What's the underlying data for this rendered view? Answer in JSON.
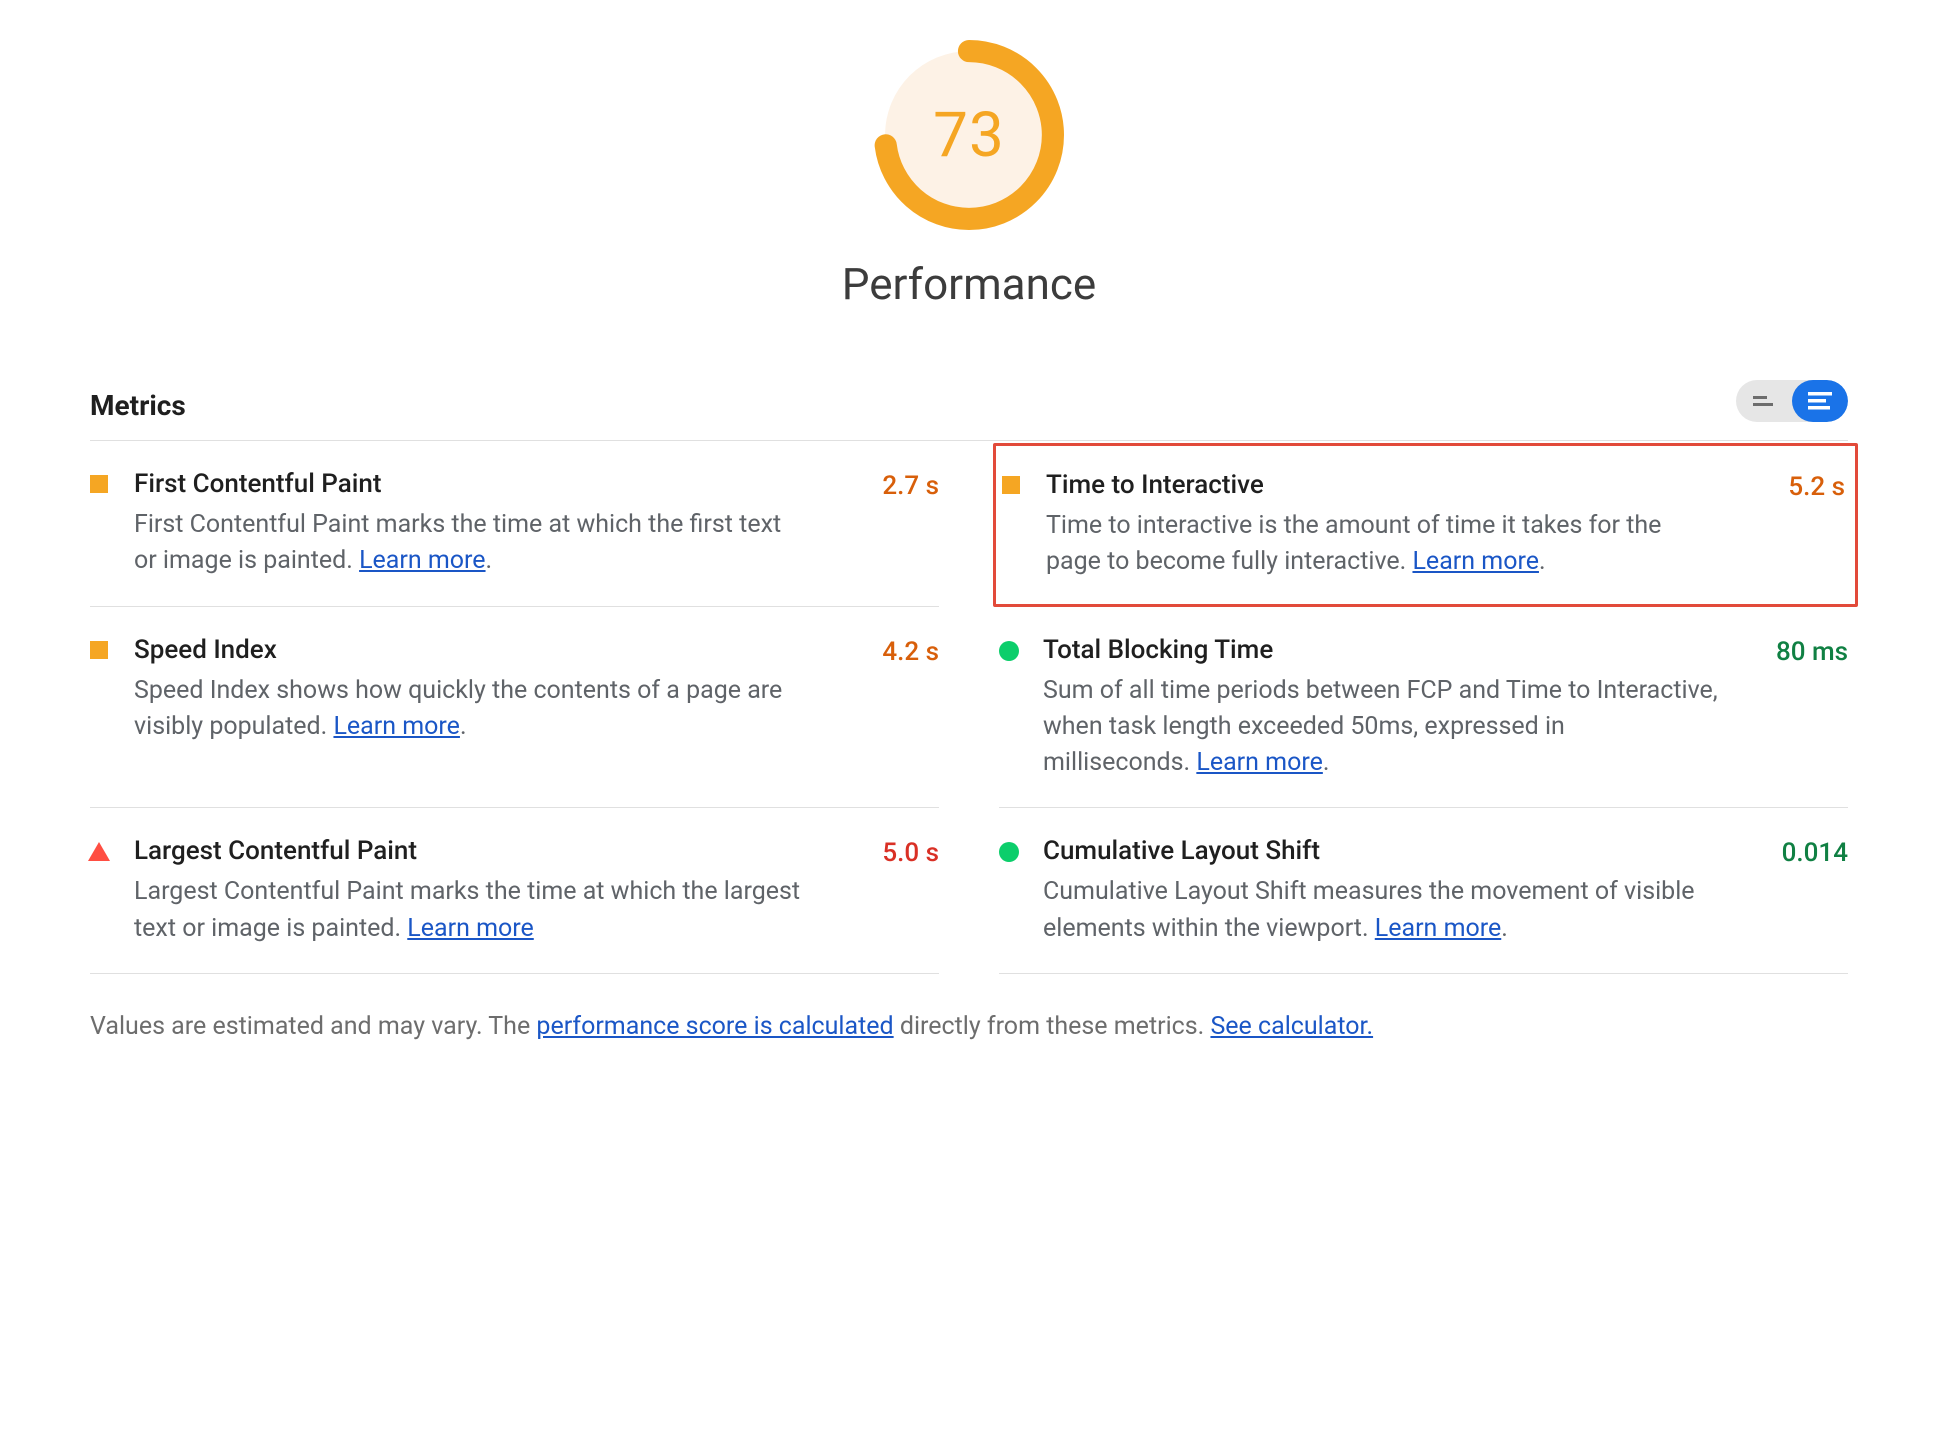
{
  "score": 73,
  "score_pct": 0.73,
  "title": "Performance",
  "section_heading": "Metrics",
  "metrics": [
    {
      "id": "fcp",
      "title": "First Contentful Paint",
      "desc_pre": "First Contentful Paint marks the time at which the first text or image is painted. ",
      "link": "Learn more",
      "desc_post": ".",
      "value": "2.7 s",
      "status": "avg",
      "icon": "square"
    },
    {
      "id": "tti",
      "title": "Time to Interactive",
      "desc_pre": "Time to interactive is the amount of time it takes for the page to become fully interactive. ",
      "link": "Learn more",
      "desc_post": ".",
      "value": "5.2 s",
      "status": "avg",
      "icon": "square",
      "highlight": true
    },
    {
      "id": "si",
      "title": "Speed Index",
      "desc_pre": "Speed Index shows how quickly the contents of a page are visibly populated. ",
      "link": "Learn more",
      "desc_post": ".",
      "value": "4.2 s",
      "status": "avg",
      "icon": "square"
    },
    {
      "id": "tbt",
      "title": "Total Blocking Time",
      "desc_pre": "Sum of all time periods between FCP and Time to Interactive, when task length exceeded 50ms, expressed in milliseconds. ",
      "link": "Learn more",
      "desc_post": ".",
      "value": "80 ms",
      "status": "pass",
      "icon": "circle"
    },
    {
      "id": "lcp",
      "title": "Largest Contentful Paint",
      "desc_pre": "Largest Contentful Paint marks the time at which the largest text or image is painted. ",
      "link": "Learn more",
      "desc_post": "",
      "value": "5.0 s",
      "status": "fail",
      "icon": "triangle"
    },
    {
      "id": "cls",
      "title": "Cumulative Layout Shift",
      "desc_pre": "Cumulative Layout Shift measures the movement of visible elements within the viewport. ",
      "link": "Learn more",
      "desc_post": ".",
      "value": "0.014",
      "status": "pass",
      "icon": "circle"
    }
  ],
  "footer": {
    "pre": "Values are estimated and may vary. The ",
    "link1": "performance score is calculated",
    "mid": " directly from these metrics. ",
    "link2": "See calculator."
  }
}
